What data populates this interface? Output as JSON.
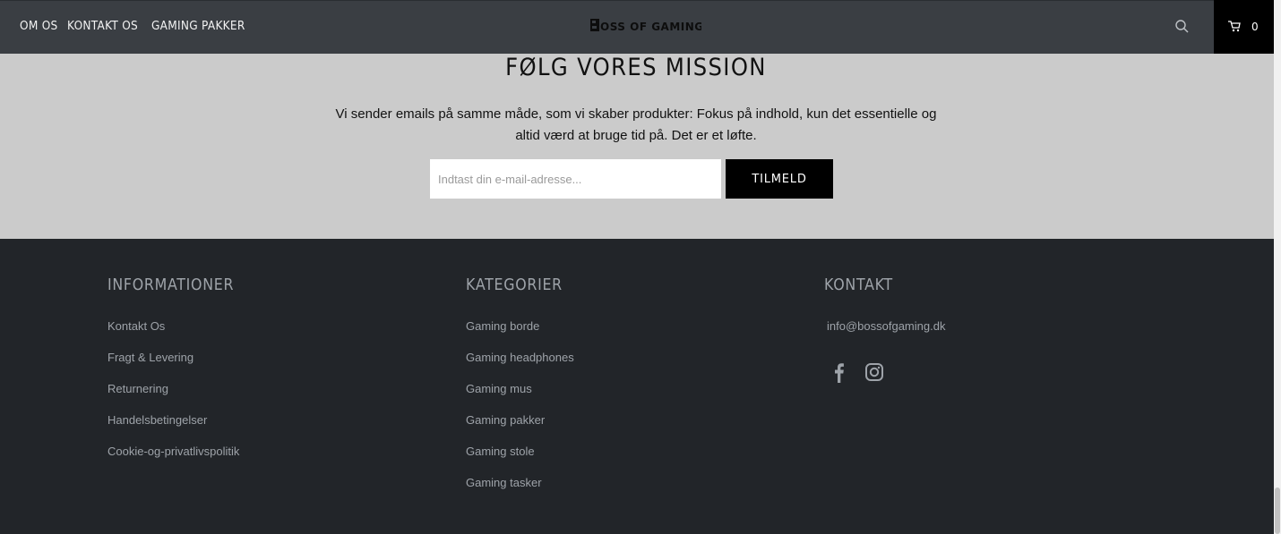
{
  "header": {
    "nav": [
      "OM OS",
      "KONTAKT OS",
      "GAMING PAKKER"
    ],
    "logo_text": "BOSS OF GAMING",
    "cart_count": "0",
    "search_icon": "search-icon",
    "cart_icon": "cart-icon"
  },
  "newsletter": {
    "title": "FØLG VORES MISSION",
    "text_line1": "Vi sender emails på samme måde, som vi skaber produkter: Fokus på indhold, kun det essentielle og",
    "text_line2": "altid værd at bruge tid på. Det er et løfte.",
    "input_placeholder": "Indtast din e-mail-adresse...",
    "input_value": "",
    "button_label": "TILMELD"
  },
  "footer": {
    "informationer": {
      "title": "INFORMATIONER",
      "links": [
        "Kontakt Os",
        "Fragt & Levering",
        "Returnering",
        "Handelsbetingelser",
        "Cookie-og-privatlivspolitik"
      ]
    },
    "kategorier": {
      "title": "KATEGORIER",
      "links": [
        "Gaming borde",
        "Gaming headphones",
        "Gaming mus",
        "Gaming pakker",
        "Gaming stole",
        "Gaming tasker"
      ]
    },
    "kontakt": {
      "title": "KONTAKT",
      "email": "info@bossofgaming.dk",
      "social_icons": [
        "facebook-icon",
        "instagram-icon"
      ]
    }
  },
  "colors": {
    "header_bg": "#3a3e43",
    "newsletter_bg": "#cbcbcb",
    "footer_bg": "#222529",
    "footer_text": "#9ea3a9",
    "button_bg": "#000000"
  }
}
